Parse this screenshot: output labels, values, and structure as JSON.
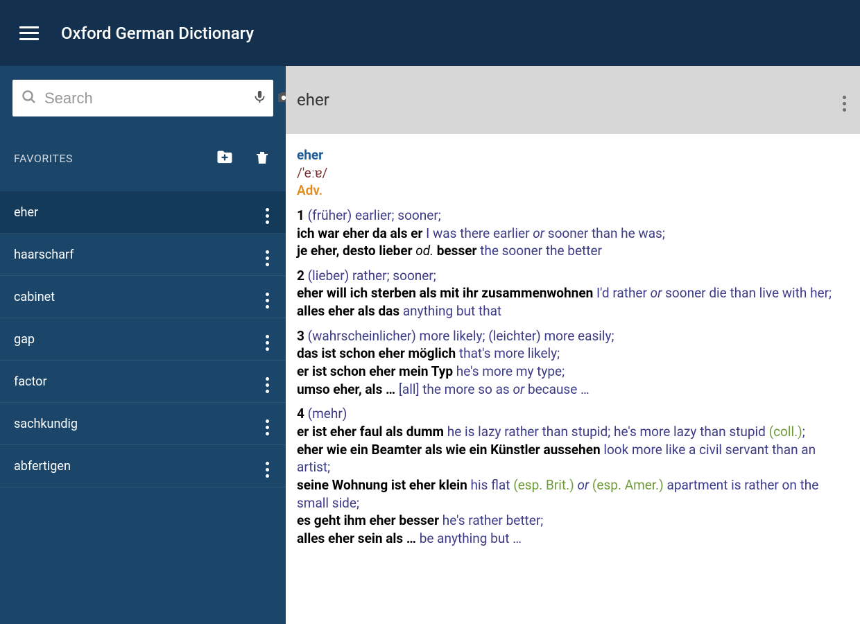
{
  "header": {
    "title": "Oxford German Dictionary"
  },
  "search": {
    "placeholder": "Search",
    "value": ""
  },
  "favorites": {
    "label": "FAVORITES",
    "items": [
      {
        "label": "eher",
        "selected": true
      },
      {
        "label": "haarscharf"
      },
      {
        "label": "cabinet"
      },
      {
        "label": "gap"
      },
      {
        "label": "factor"
      },
      {
        "label": "sachkundig"
      },
      {
        "label": "abfertigen"
      }
    ]
  },
  "entry": {
    "word": "eher",
    "headword": "eher",
    "pron": "/'eːɐ/",
    "pos": "Adv.",
    "senses": [
      {
        "n": "1",
        "gram": "(früher)",
        "gloss": "earlier; sooner;",
        "examples": [
          {
            "de": "ich war eher da als er",
            "tr": "I was there earlier",
            "it": "or",
            "tr2": "sooner than he was;"
          },
          {
            "de": "je eher, desto lieber",
            "mid": "od.",
            "de2": "besser",
            "tr": "the sooner the better"
          }
        ]
      },
      {
        "n": "2",
        "gram": "(lieber)",
        "gloss": "rather; sooner;",
        "examples": [
          {
            "de": "eher will ich sterben als mit ihr zusammenwohnen",
            "tr": "I'd rather",
            "it": "or",
            "tr2": "sooner die than live with her;"
          },
          {
            "de": "alles eher als das",
            "tr": "anything but that"
          }
        ]
      },
      {
        "n": "3",
        "gram": "(wahrscheinlicher)",
        "gloss": "more likely;",
        "gram2": "(leichter)",
        "gloss2": "more easily;",
        "examples": [
          {
            "de": "das ist schon eher möglich",
            "tr": "that's more likely;"
          },
          {
            "de": "er ist schon eher mein Typ",
            "tr": "he's more my type;"
          },
          {
            "de": "umso eher, als …",
            "tr": "[all] the more so as",
            "it": "or",
            "tr2": "because …"
          }
        ]
      },
      {
        "n": "4",
        "gram": "(mehr)",
        "gloss": "",
        "examples": [
          {
            "de": "er ist eher faul als dumm",
            "tr": "he is lazy rather than stupid; he's more lazy than stupid",
            "reg": "(coll.)",
            "tail": ";"
          },
          {
            "de": "eher wie ein Beamter als wie ein Künstler aussehen",
            "tr": "look more like a civil servant than an artist;"
          },
          {
            "de": "seine Wohnung ist eher klein",
            "tr": "his flat",
            "reg": "(esp. Brit.)",
            "it": "or",
            "reg2": "(esp. Amer.)",
            "tr2": "apartment is rather on the small side;"
          },
          {
            "de": "es geht ihm eher besser",
            "tr": "he's rather better;"
          },
          {
            "de": "alles eher sein als …",
            "tr": "be anything but …"
          }
        ]
      }
    ]
  }
}
